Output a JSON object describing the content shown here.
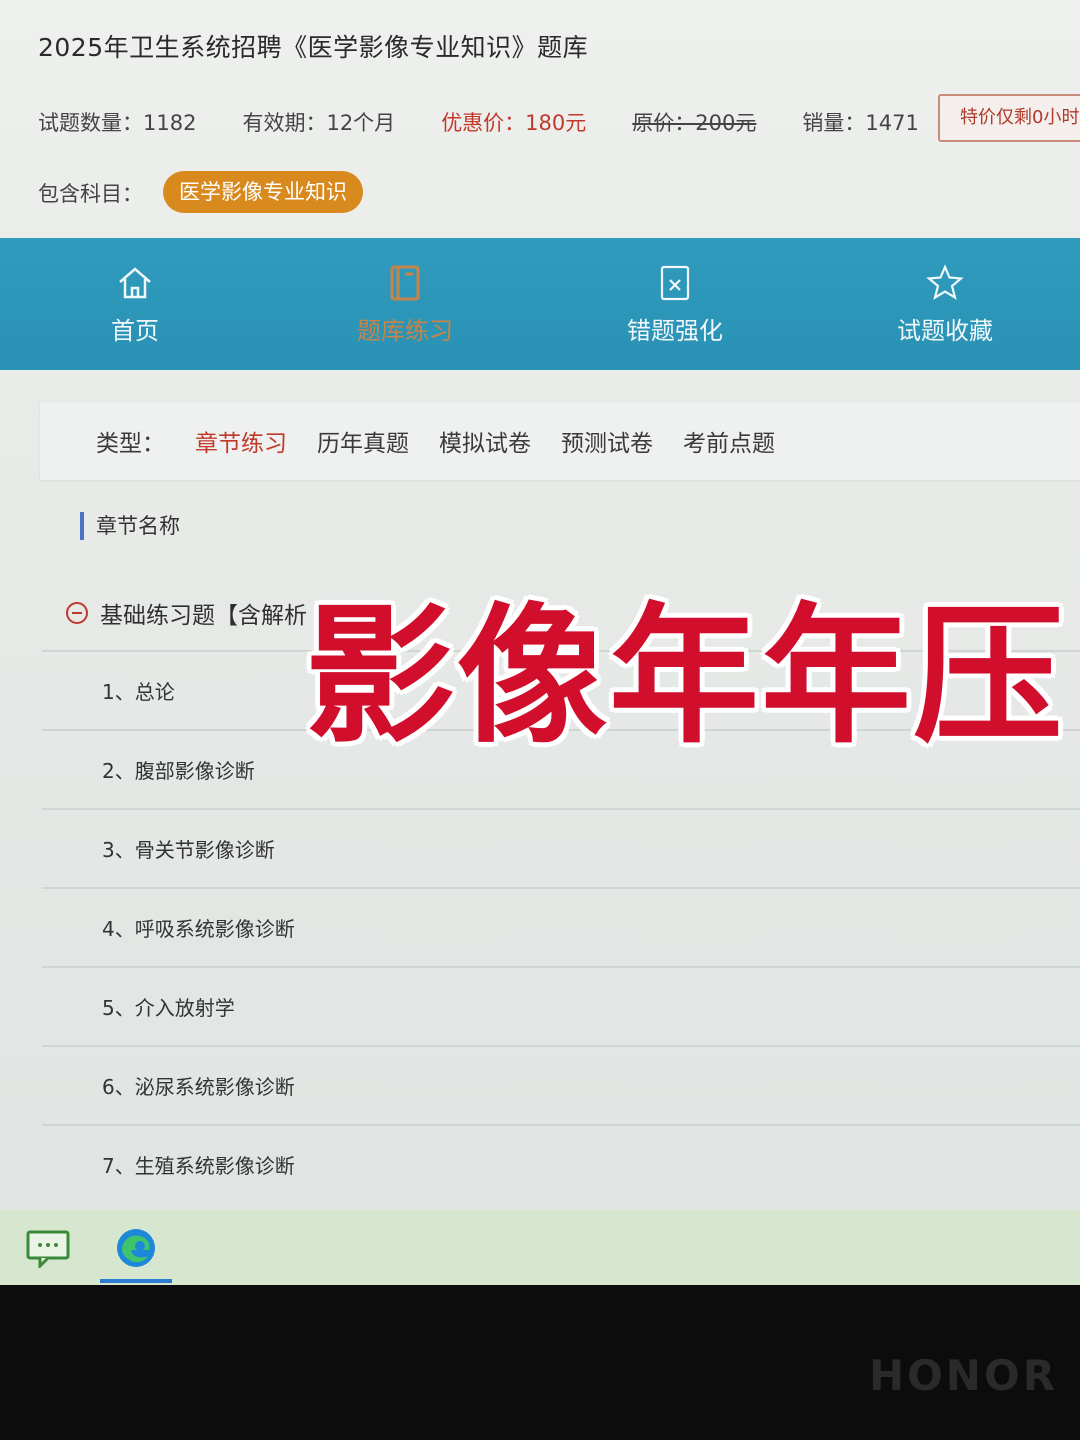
{
  "product": {
    "title": "2025年卫生系统招聘《医学影像专业知识》题库",
    "question_count": "试题数量：1182",
    "validity": "有效期：12个月",
    "sale_price": "优惠价：180元",
    "original_price": "原价：200元",
    "sales": "销量：1471",
    "promo": "特价仅剩0小时",
    "subject_label": "包含科目：",
    "subject_chip": "医学影像专业知识"
  },
  "nav": {
    "items": [
      {
        "label": "首页",
        "icon": "home-icon"
      },
      {
        "label": "题库练习",
        "icon": "book-icon",
        "active": true
      },
      {
        "label": "错题强化",
        "icon": "wrong-answer-icon"
      },
      {
        "label": "试题收藏",
        "icon": "star-icon"
      }
    ]
  },
  "types": {
    "label": "类型：",
    "options": [
      "章节练习",
      "历年真题",
      "模拟试卷",
      "预测试卷",
      "考前点题"
    ],
    "active": "章节练习"
  },
  "chapters": {
    "header": "章节名称",
    "group": "基础练习题【含解析",
    "items": [
      "1、总论",
      "2、腹部影像诊断",
      "3、骨关节影像诊断",
      "4、呼吸系统影像诊断",
      "5、介入放射学",
      "6、泌尿系统影像诊断",
      "7、生殖系统影像诊断"
    ]
  },
  "overlay_text": "影像年年压",
  "taskbar": {
    "apps": [
      "chat-app-icon",
      "edge-browser-icon"
    ]
  },
  "device_brand": "HONOR",
  "colors": {
    "nav_bg": "#2f9bbd",
    "accent_red": "#c0392b",
    "chip_orange": "#d98a1e",
    "overlay_red": "#d10f2c"
  }
}
